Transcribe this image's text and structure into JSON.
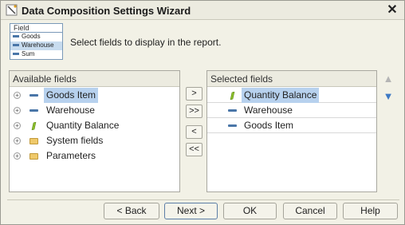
{
  "window": {
    "title": "Data Composition Settings Wizard",
    "close_glyph": "✕"
  },
  "legend": {
    "header": "Field",
    "rows": [
      "Goods",
      "Warehouse",
      "Sum"
    ]
  },
  "hint": "Select fields to display in the report.",
  "available": {
    "header": "Available fields",
    "items": [
      {
        "label": "Goods Item",
        "icon": "dash-icon",
        "selected": true
      },
      {
        "label": "Warehouse",
        "icon": "dash-icon",
        "selected": false
      },
      {
        "label": "Quantity Balance",
        "icon": "resource-icon",
        "selected": false
      },
      {
        "label": "System fields",
        "icon": "folder-icon",
        "selected": false
      },
      {
        "label": "Parameters",
        "icon": "folder-icon",
        "selected": false
      }
    ]
  },
  "selected": {
    "header": "Selected fields",
    "items": [
      {
        "label": "Quantity Balance",
        "icon": "resource-icon",
        "selected": true
      },
      {
        "label": "Warehouse",
        "icon": "dash-icon",
        "selected": false
      },
      {
        "label": "Goods Item",
        "icon": "dash-icon",
        "selected": false
      }
    ]
  },
  "move_buttons": {
    "add": ">",
    "add_all": ">>",
    "remove": "<",
    "remove_all": "<<"
  },
  "order_buttons": {
    "up": "▲",
    "down": "▼"
  },
  "buttons": {
    "back": "< Back",
    "next": "Next >",
    "ok": "OK",
    "cancel": "Cancel",
    "help": "Help"
  },
  "colors": {
    "selection": "#b7d1ee",
    "accent_blue": "#4a76a8",
    "resource_green": "#8bbf2a",
    "folder_yellow": "#efc96a"
  }
}
